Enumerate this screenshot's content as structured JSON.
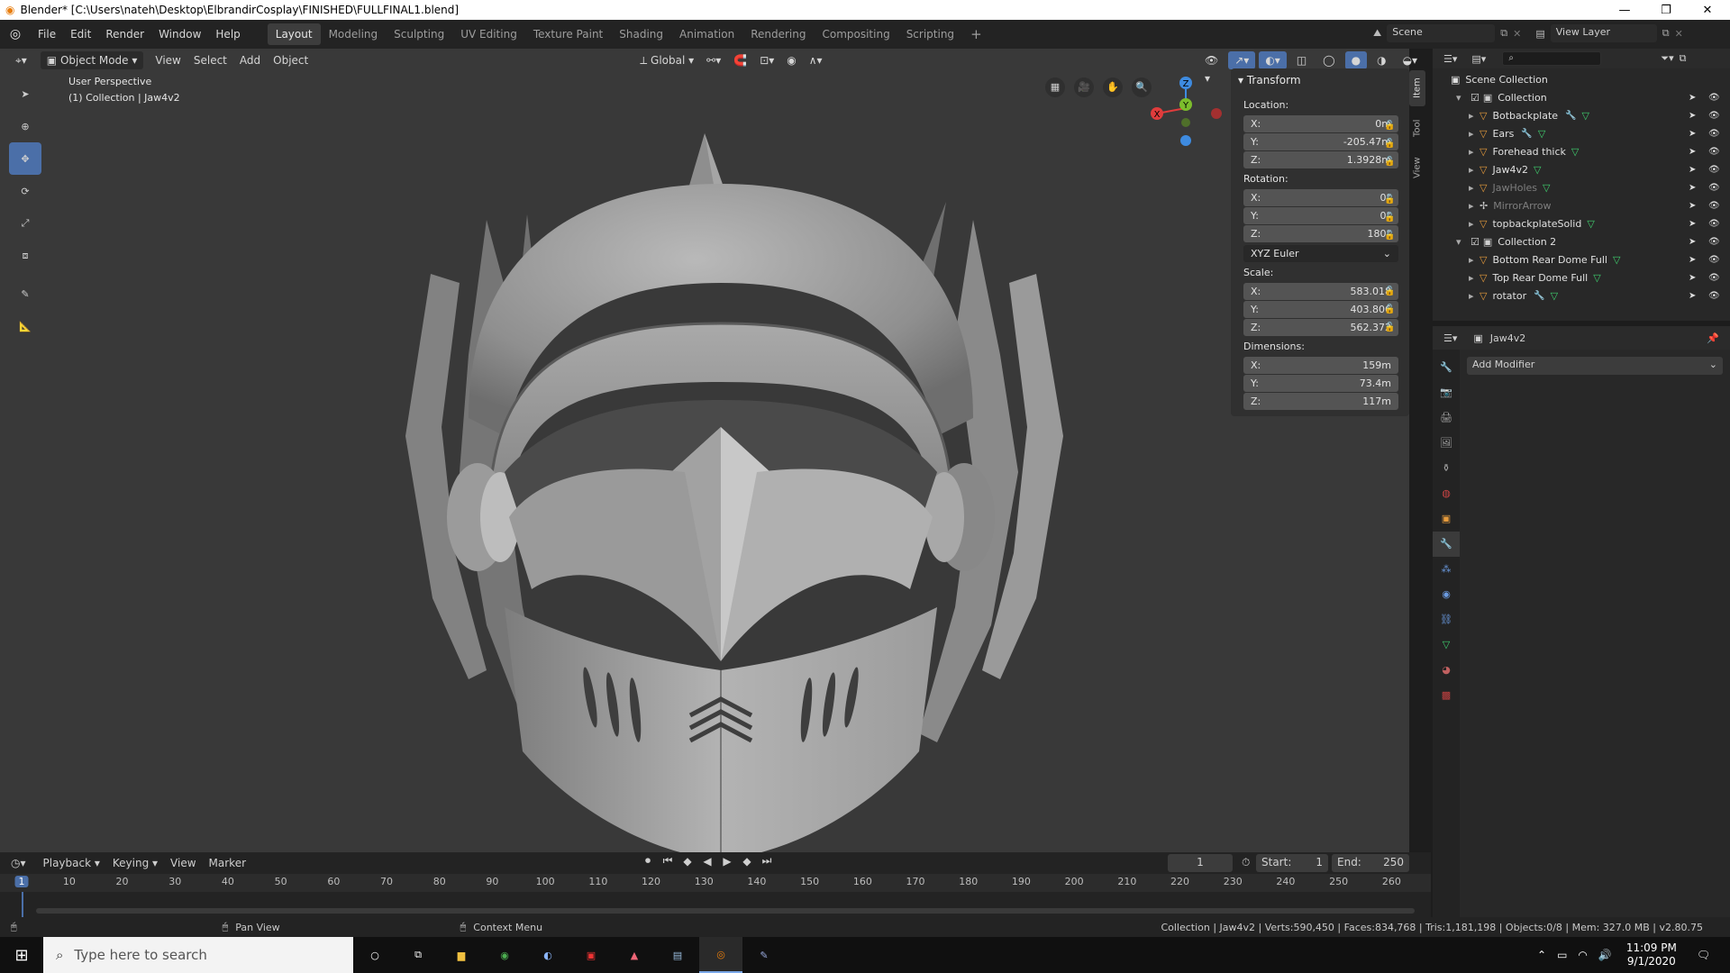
{
  "window": {
    "title": "Blender* [C:\\Users\\nateh\\Desktop\\ElbrandirCosplay\\FINISHED\\FULLFINAL1.blend]"
  },
  "menu": [
    "File",
    "Edit",
    "Render",
    "Window",
    "Help"
  ],
  "workspaces": [
    "Layout",
    "Modeling",
    "Sculpting",
    "UV Editing",
    "Texture Paint",
    "Shading",
    "Animation",
    "Rendering",
    "Compositing",
    "Scripting"
  ],
  "active_workspace": "Layout",
  "scene": {
    "name": "Scene",
    "view_layer": "View Layer"
  },
  "viewport_header": {
    "mode": "Object Mode",
    "menus": [
      "View",
      "Select",
      "Add",
      "Object"
    ],
    "orientation": "Global"
  },
  "viewport": {
    "perspective_label": "User Perspective",
    "collection_label": "(1) Collection | Jaw4v2",
    "gizmo_axes": {
      "x": "X",
      "y": "Y",
      "z": "Z"
    }
  },
  "npanel": {
    "tabs": [
      "Item",
      "Tool",
      "View"
    ],
    "section": "Transform",
    "location_label": "Location:",
    "location": [
      {
        "axis": "X:",
        "value": "0m"
      },
      {
        "axis": "Y:",
        "value": "-205.47m"
      },
      {
        "axis": "Z:",
        "value": "1.3928m"
      }
    ],
    "rotation_label": "Rotation:",
    "rotation": [
      {
        "axis": "X:",
        "value": "0°"
      },
      {
        "axis": "Y:",
        "value": "0°"
      },
      {
        "axis": "Z:",
        "value": "180°"
      }
    ],
    "rotation_mode": "XYZ Euler",
    "scale_label": "Scale:",
    "scale": [
      {
        "axis": "X:",
        "value": "583.018"
      },
      {
        "axis": "Y:",
        "value": "403.806"
      },
      {
        "axis": "Z:",
        "value": "562.372"
      }
    ],
    "dimensions_label": "Dimensions:",
    "dimensions": [
      {
        "axis": "X:",
        "value": "159m"
      },
      {
        "axis": "Y:",
        "value": "73.4m"
      },
      {
        "axis": "Z:",
        "value": "117m"
      }
    ]
  },
  "outliner": {
    "root": "Scene Collection",
    "items": [
      {
        "name": "Collection",
        "kind": "collection",
        "level": 1,
        "dim": false
      },
      {
        "name": "Botbackplate",
        "kind": "mesh",
        "level": 2,
        "dim": false,
        "wrench": true
      },
      {
        "name": "Ears",
        "kind": "mesh",
        "level": 2,
        "dim": false,
        "wrench": true
      },
      {
        "name": "Forehead thick",
        "kind": "mesh",
        "level": 2,
        "dim": false,
        "wrench": false
      },
      {
        "name": "Jaw4v2",
        "kind": "mesh",
        "level": 2,
        "dim": false,
        "wrench": false
      },
      {
        "name": "JawHoles",
        "kind": "mesh",
        "level": 2,
        "dim": true,
        "wrench": false
      },
      {
        "name": "MirrorArrow",
        "kind": "empty",
        "level": 2,
        "dim": true,
        "wrench": false
      },
      {
        "name": "topbackplateSolid",
        "kind": "mesh",
        "level": 2,
        "dim": false,
        "wrench": false
      },
      {
        "name": "Collection 2",
        "kind": "collection",
        "level": 1,
        "dim": false
      },
      {
        "name": "Bottom Rear Dome Full",
        "kind": "mesh",
        "level": 2,
        "dim": false,
        "wrench": false
      },
      {
        "name": "Top Rear Dome Full",
        "kind": "mesh",
        "level": 2,
        "dim": false,
        "wrench": false
      },
      {
        "name": "rotator",
        "kind": "mesh",
        "level": 2,
        "dim": false,
        "wrench": true
      }
    ]
  },
  "properties": {
    "object_name": "Jaw4v2",
    "add_modifier": "Add Modifier"
  },
  "timeline": {
    "menus": [
      "Playback",
      "Keying",
      "View",
      "Marker"
    ],
    "current_frame": "1",
    "start_label": "Start:",
    "start": "1",
    "end_label": "End:",
    "end": "250",
    "ticks": [
      "1",
      "10",
      "20",
      "30",
      "40",
      "50",
      "60",
      "70",
      "80",
      "90",
      "100",
      "110",
      "120",
      "130",
      "140",
      "150",
      "160",
      "170",
      "180",
      "190",
      "200",
      "210",
      "220",
      "230",
      "240",
      "250",
      "260"
    ]
  },
  "statusbar": {
    "pan": "Pan View",
    "context": "Context Menu",
    "stats": "Collection | Jaw4v2 | Verts:590,450 | Faces:834,768 | Tris:1,181,198 | Objects:0/8 | Mem: 327.0 MB | v2.80.75"
  },
  "taskbar": {
    "search_placeholder": "Type here to search",
    "time": "11:09 PM",
    "date": "9/1/2020"
  },
  "colors": {
    "accent": "#4b6fa8",
    "viewport_bg": "#393939",
    "panel_bg": "#303030",
    "orange": "#e69b3c",
    "axis_x": "#e03c3c",
    "axis_y": "#7cbd2c",
    "axis_z": "#3e8be0"
  }
}
